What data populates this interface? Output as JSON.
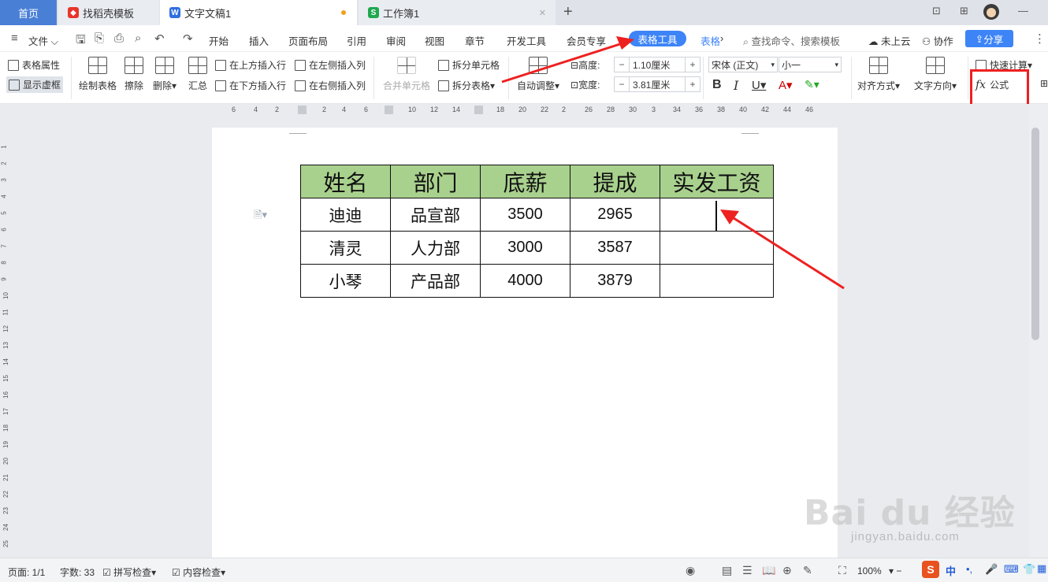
{
  "tabs": {
    "home": "首页",
    "tab1": "找稻壳模板",
    "tab2": "文字文稿1",
    "tab3": "工作簿1"
  },
  "menu": {
    "file": "文件",
    "start": "开始",
    "insert": "插入",
    "layout": "页面布局",
    "reference": "引用",
    "review": "审阅",
    "view": "视图",
    "chapter": "章节",
    "devtools": "开发工具",
    "vip": "会员专享",
    "table_tools": "表格工具",
    "table_style": "表格",
    "search": "查找命令、搜索模板",
    "cloud": "未上云",
    "collab": "协作",
    "share": "分享"
  },
  "ribbon": {
    "table_props": "表格属性",
    "show_gridlines": "显示虚框",
    "draw_table": "绘制表格",
    "erase": "擦除",
    "delete": "删除",
    "sum": "汇总",
    "insert_above": "在上方插入行",
    "insert_below": "在下方插入行",
    "insert_left": "在左侧插入列",
    "insert_right": "在右侧插入列",
    "merge_cells": "合并单元格",
    "split_cells": "拆分单元格",
    "split_table": "拆分表格",
    "auto_fit": "自动调整",
    "height_label": "高度:",
    "height_value": "1.10厘米",
    "width_label": "宽度:",
    "width_value": "3.81厘米",
    "font_name": "宋体 (正文)",
    "font_size": "小一",
    "align": "对齐方式",
    "text_dir": "文字方向",
    "quick_calc": "快速计算",
    "formula": "公式"
  },
  "ruler": {
    "h_ticks": [
      "6",
      "4",
      "2",
      "2",
      "4",
      "6",
      "10",
      "12",
      "14",
      "18",
      "20",
      "22",
      "2",
      "26",
      "28",
      "30",
      "3",
      "34",
      "36",
      "38",
      "40",
      "42",
      "44",
      "46"
    ],
    "v_ticks": [
      "1",
      "2",
      "3",
      "4",
      "5",
      "6",
      "7",
      "8",
      "9",
      "10",
      "11",
      "12",
      "13",
      "14",
      "15",
      "16",
      "17",
      "18",
      "19",
      "20",
      "21",
      "22",
      "23",
      "24",
      "25"
    ]
  },
  "table": {
    "headers": [
      "姓名",
      "部门",
      "底薪",
      "提成",
      "实发工资"
    ],
    "rows": [
      [
        "迪迪",
        "品宣部",
        "3500",
        "2965",
        ""
      ],
      [
        "清灵",
        "人力部",
        "3000",
        "3587",
        ""
      ],
      [
        "小琴",
        "产品部",
        "4000",
        "3879",
        ""
      ]
    ]
  },
  "status": {
    "page": "页面: 1/1",
    "words": "字数: 33",
    "spell": "拼写检查",
    "content": "内容检查",
    "zoom": "100%"
  },
  "watermark": {
    "main": "Bai du 经验",
    "sub": "jingyan.baidu.com"
  },
  "colors": {
    "accent": "#3d84f7",
    "header_fill": "#a9d18e",
    "annotation": "#ee2020"
  }
}
